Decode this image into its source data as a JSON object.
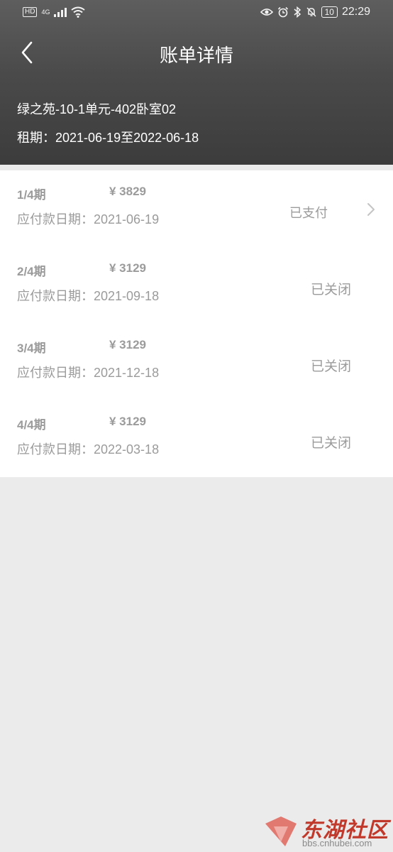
{
  "status_bar": {
    "hd": "HD",
    "network": "4G",
    "battery": "10",
    "time": "22:29"
  },
  "header": {
    "title": "账单详情",
    "house": "绿之苑-10-1单元-402卧室02",
    "lease": "租期：2021-06-19至2022-06-18"
  },
  "bills": [
    {
      "period": "1/4期",
      "amount": "¥ 3829",
      "due": "应付款日期：2021-06-19",
      "status": "已支付"
    },
    {
      "period": "2/4期",
      "amount": "¥ 3129",
      "due": "应付款日期：2021-09-18",
      "status": "已关闭"
    },
    {
      "period": "3/4期",
      "amount": "¥ 3129",
      "due": "应付款日期：2021-12-18",
      "status": "已关闭"
    },
    {
      "period": "4/4期",
      "amount": "¥ 3129",
      "due": "应付款日期：2022-03-18",
      "status": "已关闭"
    }
  ],
  "watermark": {
    "name": "东湖社区",
    "url": "bbs.cnhubei.com"
  }
}
